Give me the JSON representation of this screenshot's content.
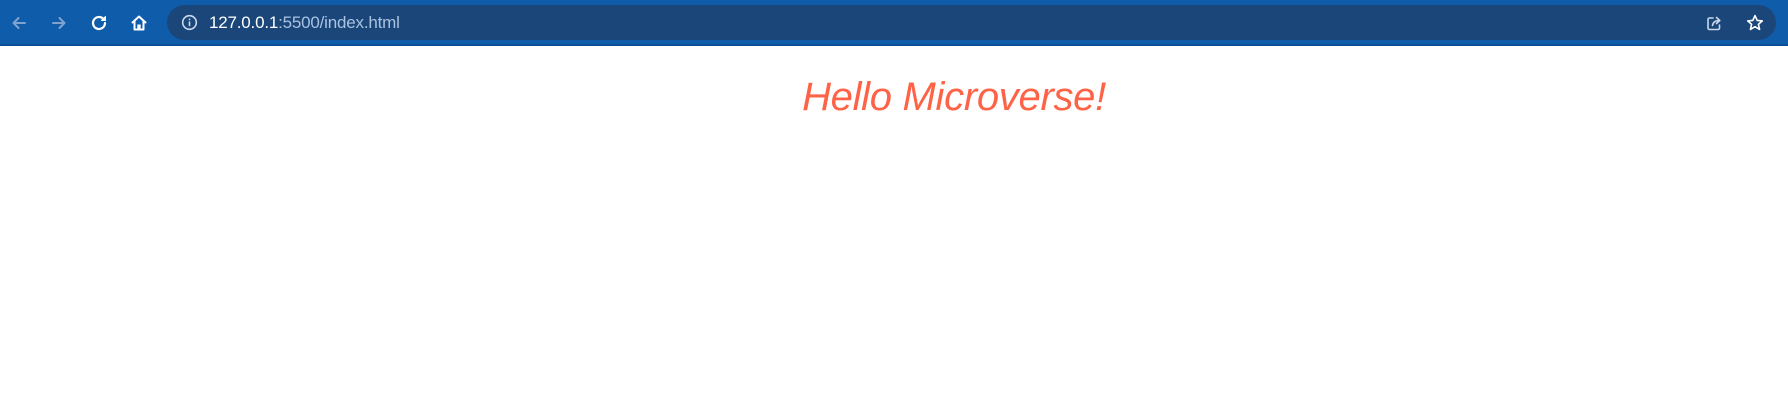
{
  "browser": {
    "url_host": "127.0.0.1",
    "url_path": ":5500/index.html",
    "icons": {
      "back": "arrow-left-icon",
      "forward": "arrow-right-icon",
      "reload": "reload-icon",
      "home": "home-icon",
      "site_info": "info-circle-icon",
      "share": "share-icon",
      "bookmark": "star-icon"
    },
    "colors": {
      "toolbar": "#0f5cab",
      "omnibox": "#1b467a"
    }
  },
  "page": {
    "heading": "Hello Microverse!",
    "heading_color": "#ff6347"
  }
}
